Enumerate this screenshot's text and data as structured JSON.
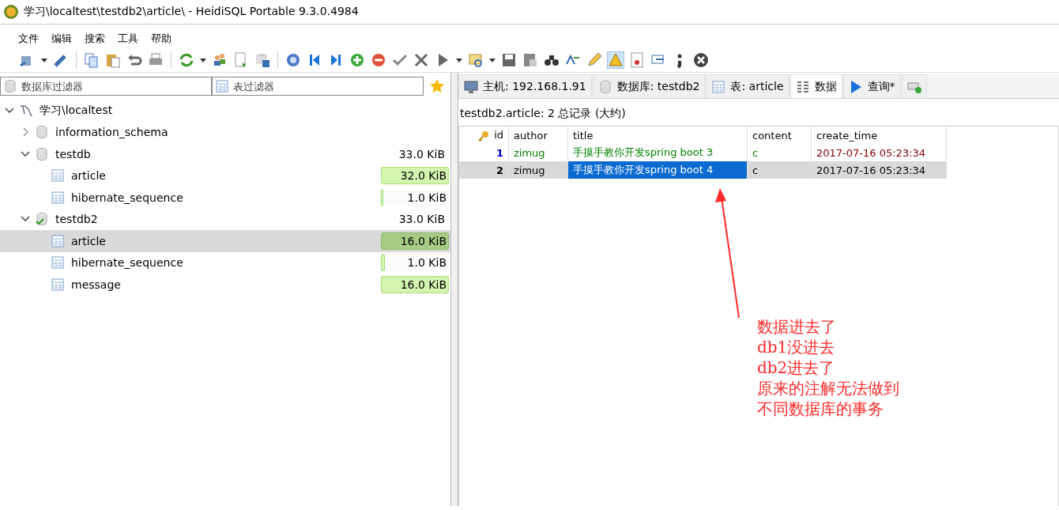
{
  "window": {
    "title": "学习\\localtest\\testdb2\\article\\ - HeidiSQL Portable 9.3.0.4984"
  },
  "menu": [
    "文件",
    "编辑",
    "搜索",
    "工具",
    "帮助"
  ],
  "filters": [
    {
      "kind": "database",
      "placeholder": "数据库过滤器"
    },
    {
      "kind": "table",
      "placeholder": "表过滤器"
    }
  ],
  "tree": [
    {
      "kind": "server",
      "label": "学习\\localtest",
      "expanded": true,
      "selected": false,
      "children": [
        {
          "kind": "database",
          "label": "information_schema",
          "expanded": false,
          "selected": false,
          "active": false
        },
        {
          "kind": "database",
          "label": "testdb",
          "size": "33.0 KiB",
          "expanded": true,
          "selected": false,
          "active": false,
          "children": [
            {
              "kind": "table",
              "label": "article",
              "size": "32.0 KiB",
              "level": 1.0,
              "selected": false
            },
            {
              "kind": "table",
              "label": "hibernate_sequence",
              "size": "1.0 KiB",
              "level": 0.03,
              "selected": false
            }
          ]
        },
        {
          "kind": "database",
          "label": "testdb2",
          "size": "33.0 KiB",
          "expanded": true,
          "selected": false,
          "active": true,
          "children": [
            {
              "kind": "table",
              "label": "article",
              "size": "16.0 KiB",
              "level": 1.0,
              "selected": true
            },
            {
              "kind": "table",
              "label": "hibernate_sequence",
              "size": "1.0 KiB",
              "level": 0.06,
              "selected": false
            },
            {
              "kind": "table",
              "label": "message",
              "size": "16.0 KiB",
              "level": 1.0,
              "selected": false
            }
          ]
        }
      ]
    }
  ],
  "tabs": [
    {
      "kind": "host",
      "label": "主机: 192.168.1.91",
      "selected": false
    },
    {
      "kind": "database",
      "label": "数据库: testdb2",
      "selected": false
    },
    {
      "kind": "table",
      "label": "表: article",
      "selected": false
    },
    {
      "kind": "data",
      "label": "数据",
      "selected": true
    },
    {
      "kind": "query",
      "label": "查询*",
      "selected": false
    },
    {
      "kind": "new",
      "selected": false
    }
  ],
  "info": "testdb2.article: 2 总记录 (大约)",
  "table": {
    "columns": [
      {
        "label": "id",
        "key": true,
        "kind": "integer"
      },
      {
        "label": "author",
        "kind": "text"
      },
      {
        "label": "title",
        "kind": "text"
      },
      {
        "label": "content",
        "kind": "text"
      },
      {
        "label": "create_time",
        "kind": "datetime"
      }
    ],
    "rows": [
      {
        "selected": false,
        "cells": [
          {
            "text": "1",
            "focused": false
          },
          {
            "text": "zimug",
            "focused": false
          },
          {
            "text": "手摸手教你开发spring boot 3",
            "focused": false
          },
          {
            "text": "c",
            "focused": false
          },
          {
            "text": "2017-07-16 05:23:34",
            "focused": false
          }
        ]
      },
      {
        "selected": true,
        "cells": [
          {
            "text": "2",
            "focused": false
          },
          {
            "text": "zimug",
            "focused": false
          },
          {
            "text": "手摸手教你开发spring boot 4",
            "focused": true
          },
          {
            "text": "c",
            "focused": false
          },
          {
            "text": "2017-07-16 05:23:34",
            "focused": false
          }
        ]
      }
    ]
  },
  "annotation": {
    "lines": [
      "数据进去了",
      "db1没进去",
      "db2进去了",
      "原来的注解无法做到",
      "不同数据库的事务"
    ]
  }
}
